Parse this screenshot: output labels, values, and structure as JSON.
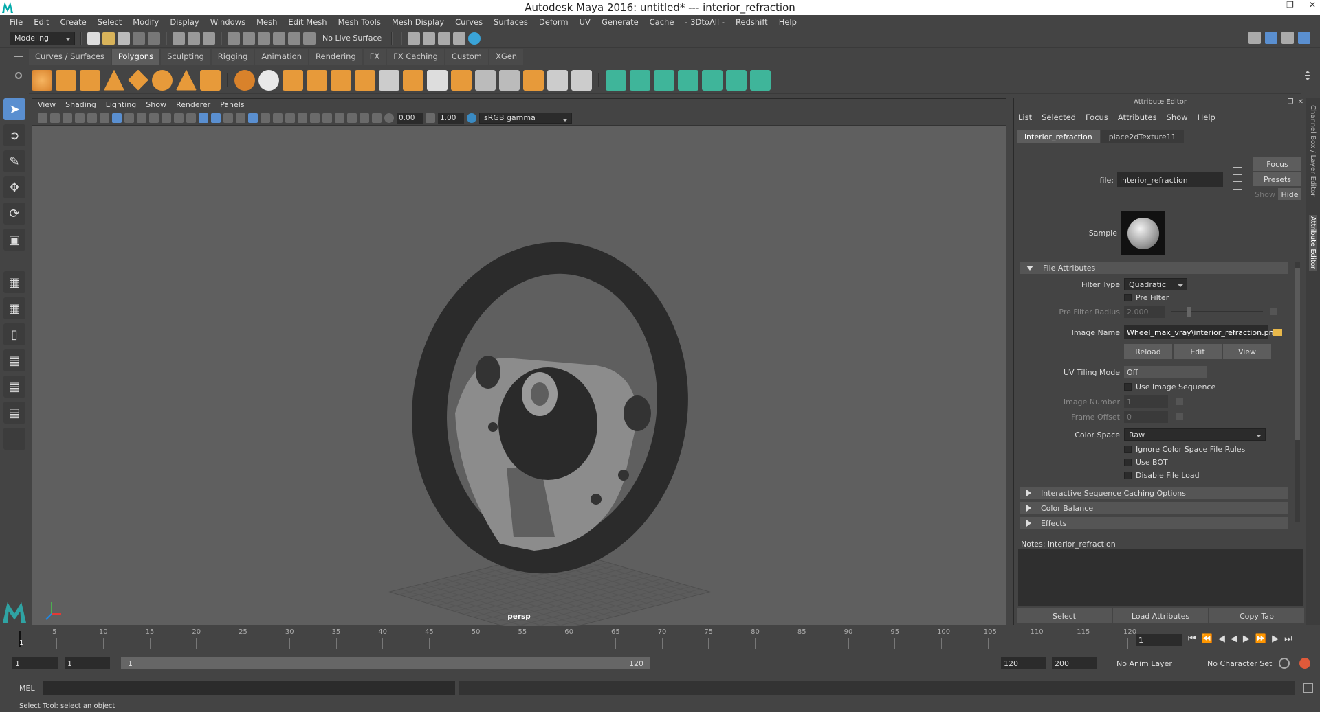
{
  "window": {
    "title": "Autodesk Maya 2016: untitled*   ---   interior_refraction"
  },
  "menubar": [
    "File",
    "Edit",
    "Create",
    "Select",
    "Modify",
    "Display",
    "Windows",
    "Mesh",
    "Edit Mesh",
    "Mesh Tools",
    "Mesh Display",
    "Curves",
    "Surfaces",
    "Deform",
    "UV",
    "Generate",
    "Cache",
    "- 3DtoAll -",
    "Redshift",
    "Help"
  ],
  "statusline": {
    "mode": "Modeling",
    "live_surface": "No Live Surface"
  },
  "shelf_tabs": [
    "Curves / Surfaces",
    "Polygons",
    "Sculpting",
    "Rigging",
    "Animation",
    "Rendering",
    "FX",
    "FX Caching",
    "Custom",
    "XGen"
  ],
  "shelf_active_tab": "Polygons",
  "viewport": {
    "menu": [
      "View",
      "Shading",
      "Lighting",
      "Show",
      "Renderer",
      "Panels"
    ],
    "exposure": "0.00",
    "gamma": "1.00",
    "color_space": "sRGB gamma",
    "camera": "persp"
  },
  "attribute_editor": {
    "header": "Attribute Editor",
    "menu": [
      "List",
      "Selected",
      "Focus",
      "Attributes",
      "Show",
      "Help"
    ],
    "tabs": [
      "interior_refraction",
      "place2dTexture11"
    ],
    "file_label": "file:",
    "file_value": "interior_refraction",
    "focus_btn": "Focus",
    "presets_btn": "Presets",
    "show_btn": "Show",
    "hide_btn": "Hide",
    "sample_label": "Sample",
    "section_file": "File Attributes",
    "filter_type_label": "Filter Type",
    "filter_type_value": "Quadratic",
    "pre_filter_label": "Pre Filter",
    "pre_filter_radius_label": "Pre Filter Radius",
    "pre_filter_radius_value": "2.000",
    "image_name_label": "Image Name",
    "image_name_value": "Wheel_max_vray\\interior_refraction.png",
    "reload_btn": "Reload",
    "edit_btn": "Edit",
    "view_btn": "View",
    "uv_tiling_label": "UV Tiling Mode",
    "uv_tiling_value": "Off",
    "use_image_sequence": "Use Image Sequence",
    "image_number_label": "Image Number",
    "image_number_value": "1",
    "frame_offset_label": "Frame Offset",
    "frame_offset_value": "0",
    "color_space_label": "Color Space",
    "color_space_value": "Raw",
    "ignore_cs_rules": "Ignore Color Space File Rules",
    "use_bot": "Use BOT",
    "disable_file_load": "Disable File Load",
    "section_interactive": "Interactive Sequence Caching Options",
    "section_color_balance": "Color Balance",
    "section_effects": "Effects",
    "notes_label": "Notes:  interior_refraction",
    "select_btn": "Select",
    "load_attrs_btn": "Load Attributes",
    "copy_tab_btn": "Copy Tab"
  },
  "side_tabs": {
    "channel_box": "Channel Box / Layer Editor",
    "attribute_editor": "Attribute Editor"
  },
  "timeline": {
    "ticks": [
      "5",
      "10",
      "15",
      "20",
      "25",
      "30",
      "35",
      "40",
      "45",
      "50",
      "55",
      "60",
      "65",
      "70",
      "75",
      "80",
      "85",
      "90",
      "95",
      "100",
      "105",
      "110",
      "115",
      "120"
    ],
    "current_frame": "1",
    "current_frame_box": "1"
  },
  "range": {
    "start": "1",
    "inner_start": "1",
    "slider_start": "1",
    "slider_end": "120",
    "end": "120",
    "max_end": "200",
    "anim_layer": "No Anim Layer",
    "character_set": "No Character Set"
  },
  "command": {
    "lang": "MEL"
  },
  "help": {
    "text": "Select Tool: select an object"
  },
  "colors": {
    "accent": "#5a8fd0",
    "shelf_orange": "#e79a3a",
    "shelf_green": "#3fb59a"
  }
}
